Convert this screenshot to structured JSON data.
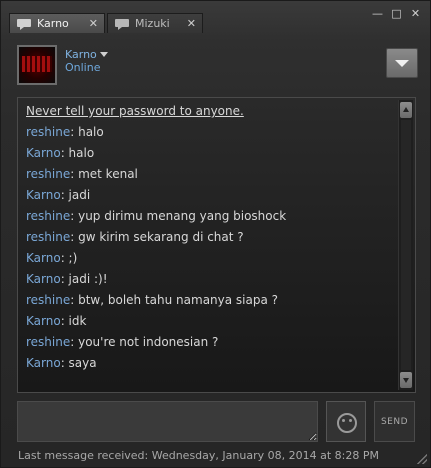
{
  "tabs": [
    {
      "label": "Karno",
      "active": true
    },
    {
      "label": "Mizuki",
      "active": false
    }
  ],
  "window_controls": {
    "minimize": "—",
    "maximize": "□",
    "close": "✕"
  },
  "contact": {
    "name": "Karno",
    "status": "Online",
    "status_color": "#6fa8dc"
  },
  "chat": {
    "warning": "Never tell your password to anyone.",
    "messages": [
      {
        "sender": "reshine",
        "text": "halo"
      },
      {
        "sender": "Karno",
        "text": "halo"
      },
      {
        "sender": "reshine",
        "text": "met kenal"
      },
      {
        "sender": "Karno",
        "text": "jadi"
      },
      {
        "sender": "reshine",
        "text": "yup dirimu menang yang bioshock"
      },
      {
        "sender": "reshine",
        "text": "gw kirim sekarang di chat ?"
      },
      {
        "sender": "Karno",
        "text": ";)"
      },
      {
        "sender": "Karno",
        "text": "jadi :)!"
      },
      {
        "sender": "reshine",
        "text": "btw, boleh tahu namanya siapa ?"
      },
      {
        "sender": "Karno",
        "text": "idk"
      },
      {
        "sender": "reshine",
        "text": "you're not indonesian ?"
      },
      {
        "sender": "Karno",
        "text": "saya"
      }
    ],
    "sender_color": "#7aa7d6"
  },
  "composer": {
    "value": "",
    "send_label": "SEND"
  },
  "footer": {
    "last_received": "Last message received: Wednesday, January 08, 2014 at 8:28 PM"
  }
}
